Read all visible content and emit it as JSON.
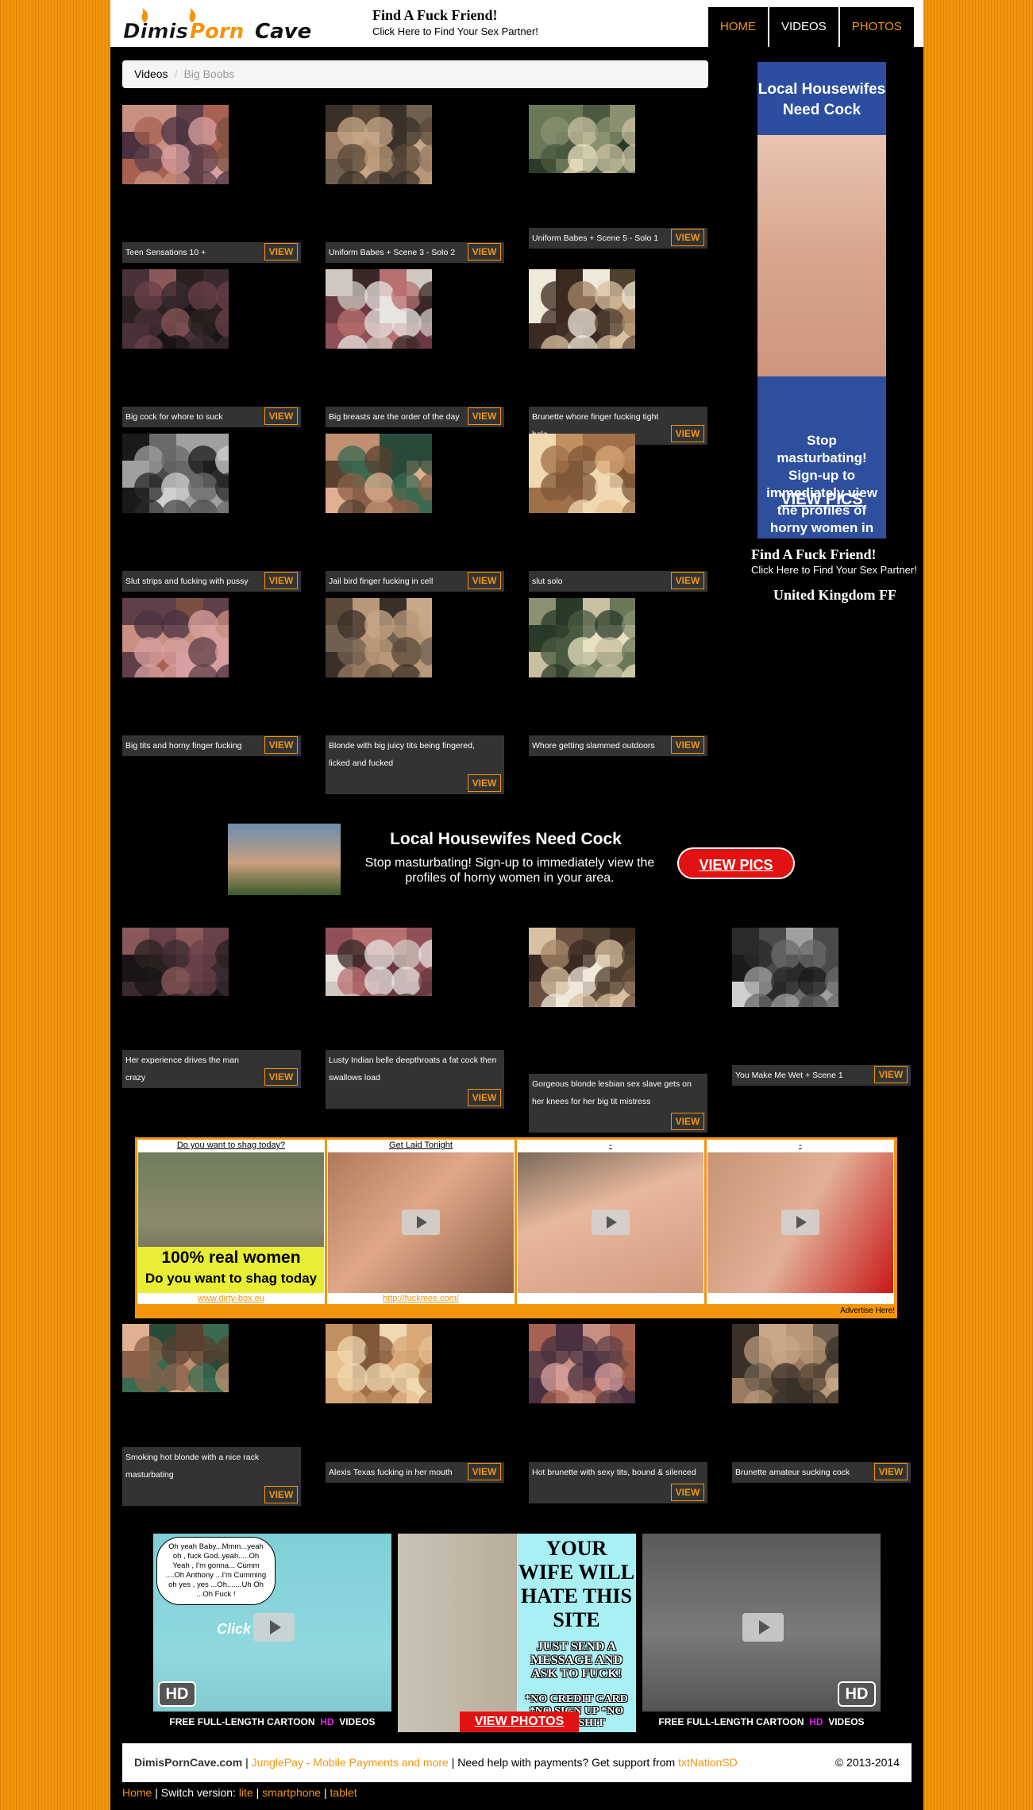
{
  "header": {
    "logo_text": "DimisPornCave",
    "ad_title": "Find A Fuck Friend!",
    "ad_subtitle": "Click Here to Find Your Sex Partner!",
    "nav": [
      {
        "label": "HOME",
        "color": "#f3950c"
      },
      {
        "label": "VIDEOS",
        "color": "#ffffff"
      },
      {
        "label": "PHOTOS",
        "color": "#f3950c"
      }
    ]
  },
  "breadcrumb": {
    "items": [
      "Videos",
      "Big Boobs"
    ],
    "separator": "/"
  },
  "view_label": "VIEW",
  "videos_top": [
    "Teen Sensations 10 +",
    "Uniform Babes + Scene 3 - Solo 2",
    "Uniform Babes + Scene 5 - Solo 1",
    "Big cock for whore to suck",
    "Big breasts are the order of the day",
    "Brunette whore finger fucking tight hole",
    "Slut strips and fucking with pussy",
    "Jail bird finger fucking in cell",
    "slut solo",
    "Big tits and horny finger fucking",
    "Blonde with big juicy tits being fingered, licked and fucked",
    "Whore getting slammed outdoors"
  ],
  "videos_mid": [
    "Her experience drives the man crazy",
    "Lusty Indian belle deepthroats a fat cock then swallows load",
    "Gorgeous blonde lesbian sex slave gets on her knees for her big tit mistress",
    "You Make Me Wet + Scene 1"
  ],
  "videos_bottom": [
    "Smoking hot blonde with a nice rack masturbating",
    "Alexis Texas fucking in her mouth",
    "Hot brunette with sexy tits, bound & silenced",
    "Brunette amateur sucking cock"
  ],
  "sidebar": {
    "banner_title": "Local Housewifes Need Cock",
    "banner_body": "Stop masturbating! Sign-up to immediately view the profiles of horny women in your area.",
    "banner_cta": "VIEW PICS",
    "ad_title": "Find A Fuck Friend!",
    "ad_subtitle": "Click Here to Find Your Sex Partner!",
    "country": "United Kingdom FF"
  },
  "wide_banner": {
    "title": "Local Housewifes Need Cock",
    "subtitle": "Stop masturbating! Sign-up to immediately view the profiles of horny women in your area.",
    "button": "VIEW PICS"
  },
  "ad_grid": {
    "cells": [
      {
        "title": "Do you want to shag today?",
        "link": "www.dirty-box.eu",
        "line1": "100% real women",
        "line2": "Do you want to shag today"
      },
      {
        "title": "Get Laid Tonight",
        "link": "http://fuckmee.com/"
      },
      {
        "title": "-",
        "link": ""
      },
      {
        "title": "-",
        "link": ""
      }
    ],
    "advertise": "Advertise Here!"
  },
  "bottom_banners": {
    "speech": "Oh yeah Baby...Mmm...yeah oh , fuck God..yeah.....Oh Yeah , I'm gonna... Cumm ....Oh Anthony ...I'm Cumming oh yes , yes ...Oh.......Uh Oh ...Oh Fuck !",
    "click": "Click",
    "hd_badge": "HD",
    "foot_pre": "FREE FULL-LENGTH CARTOON",
    "foot_hd": "HD",
    "foot_post": "VIDEOS",
    "wife_line1": "YOUR WIFE WILL HATE THIS SITE",
    "wife_line2": "JUST SEND A MESSAGE AND ASK TO FUCK!",
    "wife_line3": "*NO CREDIT CARD *NO SIGN UP *NO BULLSHIT",
    "wife_button": "VIEW PHOTOS"
  },
  "footer": {
    "brand": "DimisPornCave.com",
    "sep": "|",
    "jungle": "JunglePay - Mobile Payments and more",
    "help": "Need help with payments? Get support from",
    "txt": "txtNationSD",
    "copyright": "© 2013-2014",
    "home": "Home",
    "switch": "Switch version:",
    "lite": "lite",
    "smartphone": "smartphone",
    "tablet": "tablet"
  },
  "colors": {
    "accent": "#f3950c",
    "page_bg": "#000000",
    "caption_bg": "#333333"
  },
  "icons": [
    "flame-icon",
    "play-icon"
  ]
}
